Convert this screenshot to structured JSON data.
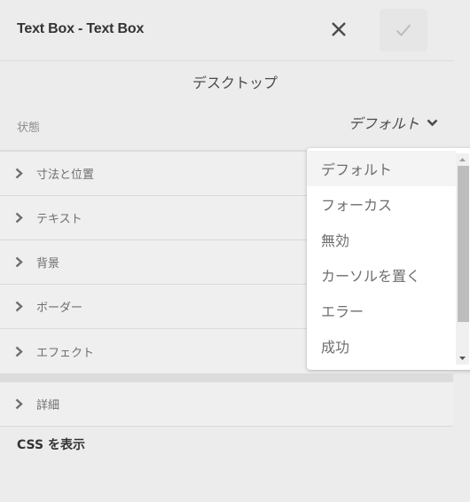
{
  "header": {
    "title": "Text Box - Text Box",
    "close_icon": "close-icon",
    "done_icon": "checkmark-icon"
  },
  "device": "デスクトップ",
  "state": {
    "label": "状態",
    "selected": "デフォルト",
    "options": [
      "デフォルト",
      "フォーカス",
      "無効",
      "カーソルを置く",
      "エラー",
      "成功"
    ]
  },
  "sections": [
    {
      "label": "寸法と位置"
    },
    {
      "label": "テキスト"
    },
    {
      "label": "背景"
    },
    {
      "label": "ボーダー"
    },
    {
      "label": "エフェクト"
    }
  ],
  "details": {
    "label": "詳細"
  },
  "css_link": "CSS を表示"
}
